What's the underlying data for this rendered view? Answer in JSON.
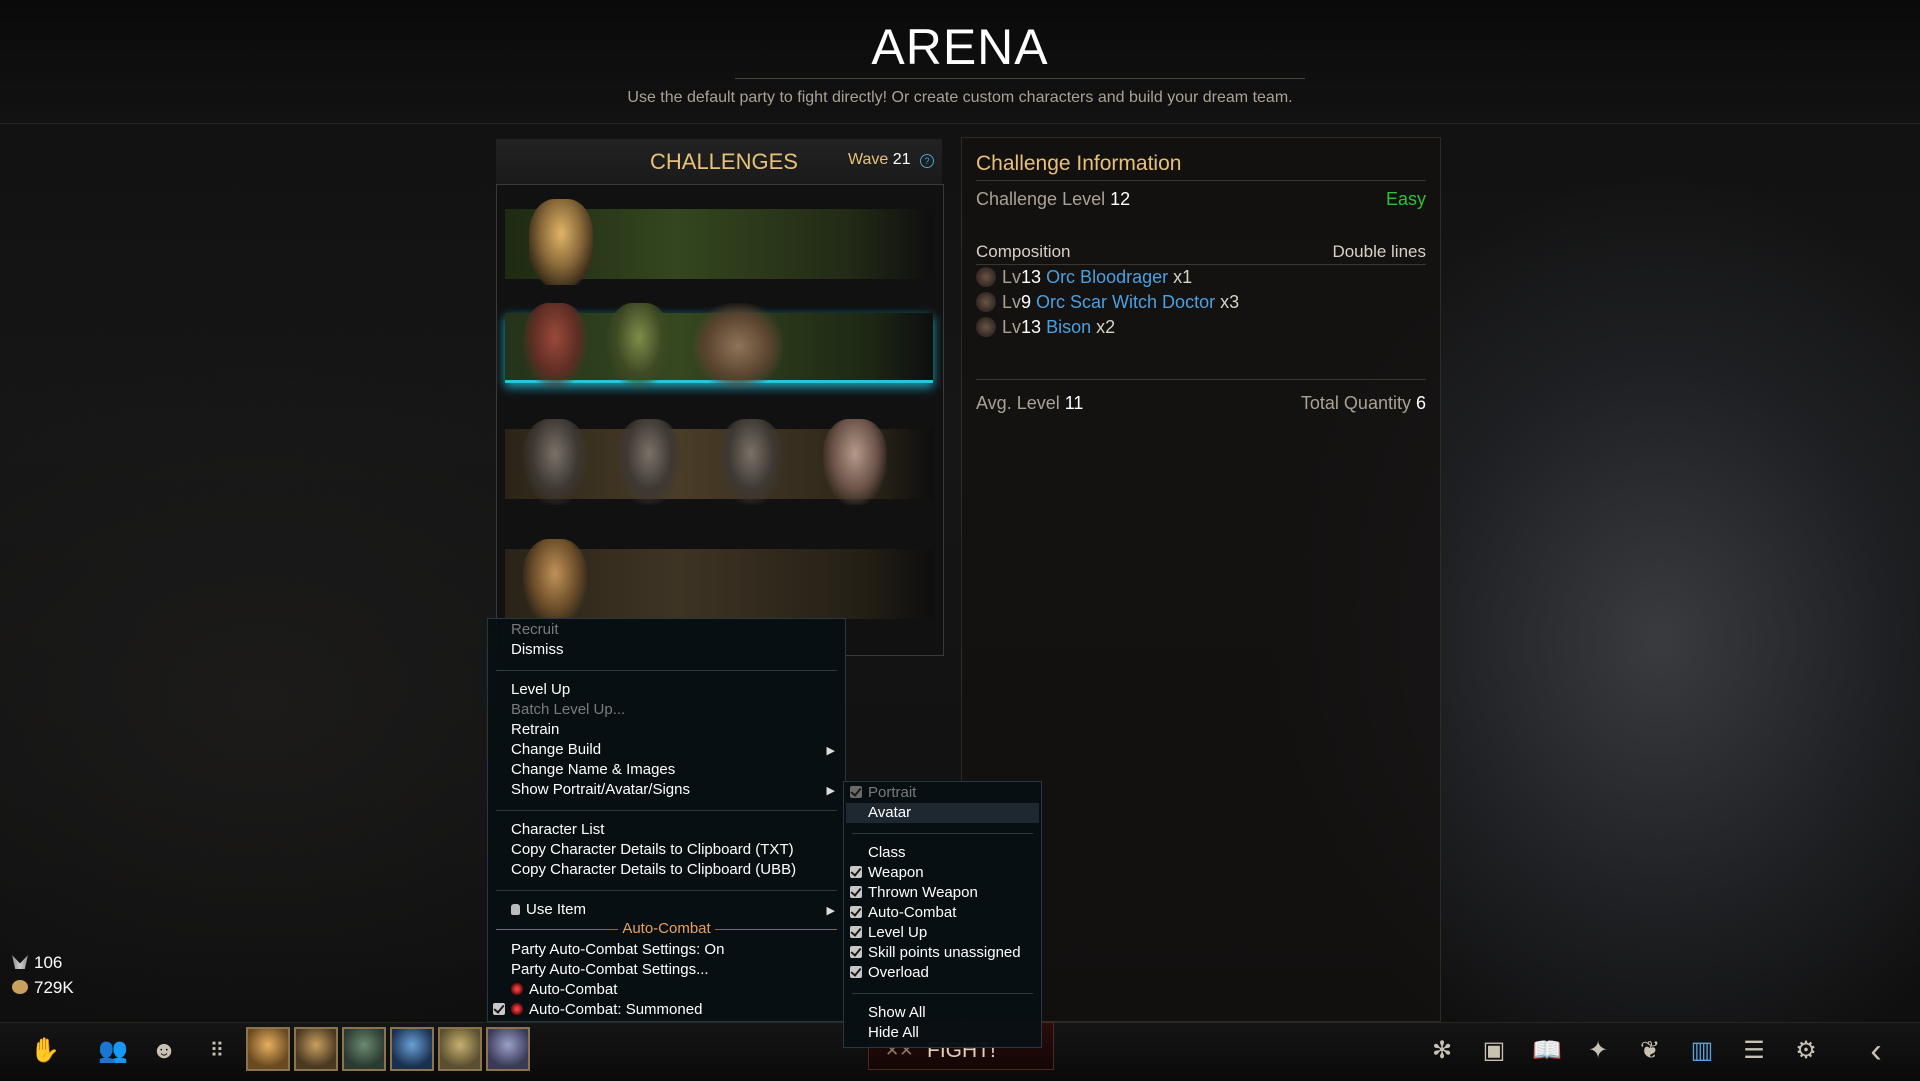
{
  "header": {
    "title": "ARENA",
    "subtitle": "Use the default party to fight directly! Or create custom characters and build your dream team."
  },
  "challenges": {
    "title": "CHALLENGES",
    "wave_label": "Wave",
    "wave_value": "21"
  },
  "info": {
    "title": "Challenge Information",
    "level_label": "Challenge Level",
    "level_value": "12",
    "difficulty": "Easy",
    "composition_label": "Composition",
    "composition_mode": "Double lines",
    "composition": [
      {
        "lv_prefix": "Lv",
        "level": "13",
        "name": "Orc Bloodrager",
        "qty": "x1"
      },
      {
        "lv_prefix": "Lv",
        "level": "9",
        "name": "Orc Scar Witch Doctor",
        "qty": "x3"
      },
      {
        "lv_prefix": "Lv",
        "level": "13",
        "name": "Bison",
        "qty": "x2"
      }
    ],
    "avg_level_label": "Avg. Level",
    "avg_level_value": "11",
    "total_qty_label": "Total Quantity",
    "total_qty_value": "6"
  },
  "context_menu": {
    "recruit": "Recruit",
    "dismiss": "Dismiss",
    "level_up": "Level Up",
    "batch_level_up": "Batch Level Up...",
    "retrain": "Retrain",
    "change_build": "Change Build",
    "change_name_images": "Change Name & Images",
    "show_portrait": "Show Portrait/Avatar/Signs",
    "character_list": "Character List",
    "copy_txt": "Copy Character Details to Clipboard (TXT)",
    "copy_ubb": "Copy Character Details to Clipboard (UBB)",
    "use_item": "Use Item",
    "auto_combat_header": "Auto-Combat",
    "party_settings_on": "Party Auto-Combat Settings: On",
    "party_settings": "Party Auto-Combat Settings...",
    "auto_combat": "Auto-Combat",
    "auto_combat_summoned": "Auto-Combat: Summoned"
  },
  "submenu": {
    "portrait": "Portrait",
    "avatar": "Avatar",
    "class": "Class",
    "weapon": "Weapon",
    "thrown_weapon": "Thrown Weapon",
    "auto_combat": "Auto-Combat",
    "level_up": "Level Up",
    "skill_points": "Skill points unassigned",
    "overload": "Overload",
    "show_all": "Show All",
    "hide_all": "Hide All"
  },
  "resources": {
    "reputation": "106",
    "gold": "729K"
  },
  "fight_button": "FIGHT!",
  "icons": {
    "help": "?",
    "arrow_right": "▶",
    "back": "‹"
  }
}
